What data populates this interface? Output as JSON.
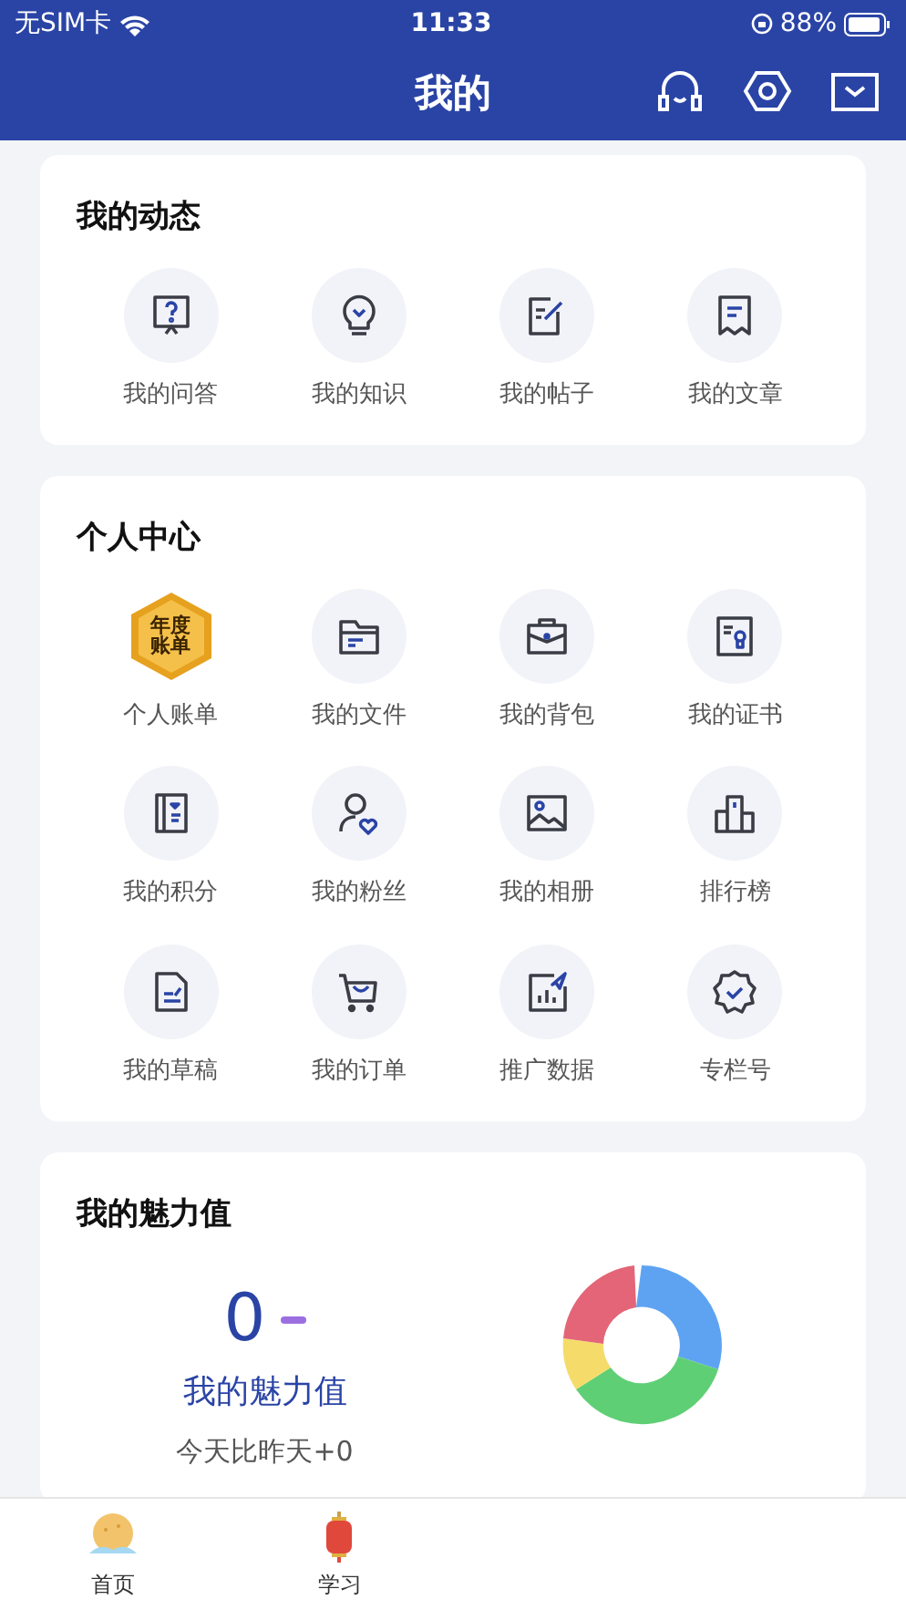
{
  "status_bar": {
    "carrier": "无SIM卡",
    "time": "11:33",
    "battery": "88%"
  },
  "header": {
    "title": "我的"
  },
  "sections": [
    {
      "title": "我的动态",
      "items": [
        {
          "label": "我的问答",
          "kind": "question"
        },
        {
          "label": "我的知识",
          "kind": "bulb"
        },
        {
          "label": "我的帖子",
          "kind": "post"
        },
        {
          "label": "我的文章",
          "kind": "article"
        }
      ]
    },
    {
      "title": "个人中心",
      "items": [
        {
          "label": "个人账单",
          "kind": "annual",
          "badge_lines": [
            "年度",
            "账单"
          ]
        },
        {
          "label": "我的文件",
          "kind": "folder"
        },
        {
          "label": "我的背包",
          "kind": "bag"
        },
        {
          "label": "我的证书",
          "kind": "cert"
        },
        {
          "label": "我的积分",
          "kind": "points"
        },
        {
          "label": "我的粉丝",
          "kind": "fans"
        },
        {
          "label": "我的相册",
          "kind": "album"
        },
        {
          "label": "排行榜",
          "kind": "rank"
        },
        {
          "label": "我的草稿",
          "kind": "draft"
        },
        {
          "label": "我的订单",
          "kind": "cart"
        },
        {
          "label": "推广数据",
          "kind": "stats"
        },
        {
          "label": "专栏号",
          "kind": "column"
        }
      ]
    }
  ],
  "charm": {
    "title": "我的魅力值",
    "value": "0",
    "label": "我的魅力值",
    "compare": "今天比昨天+0"
  },
  "tab_bar": [
    {
      "label": "首页",
      "kind": "home"
    },
    {
      "label": "学习",
      "kind": "study"
    }
  ]
}
